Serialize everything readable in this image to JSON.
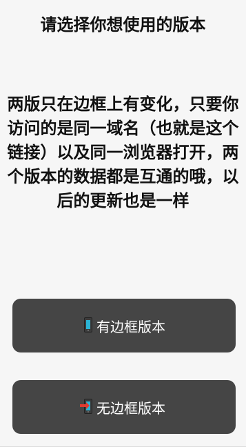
{
  "header": {
    "title": "请选择你想使用的版本"
  },
  "main": {
    "description": "两版只在边框上有变化，只要你访问的是同一域名（也就是这个链接）以及同一浏览器打开，两个版本的数据都是互通的哦，以后的更新也是一样"
  },
  "buttons": [
    {
      "label": "有边框版本",
      "icon": "mobile-phone-icon"
    },
    {
      "label": "无边框版本",
      "icon": "mobile-phone-arrow-icon"
    }
  ],
  "colors": {
    "background": "#f6f6f6",
    "button_bg": "#454545",
    "button_text": "#ffffff",
    "text": "#111111"
  }
}
